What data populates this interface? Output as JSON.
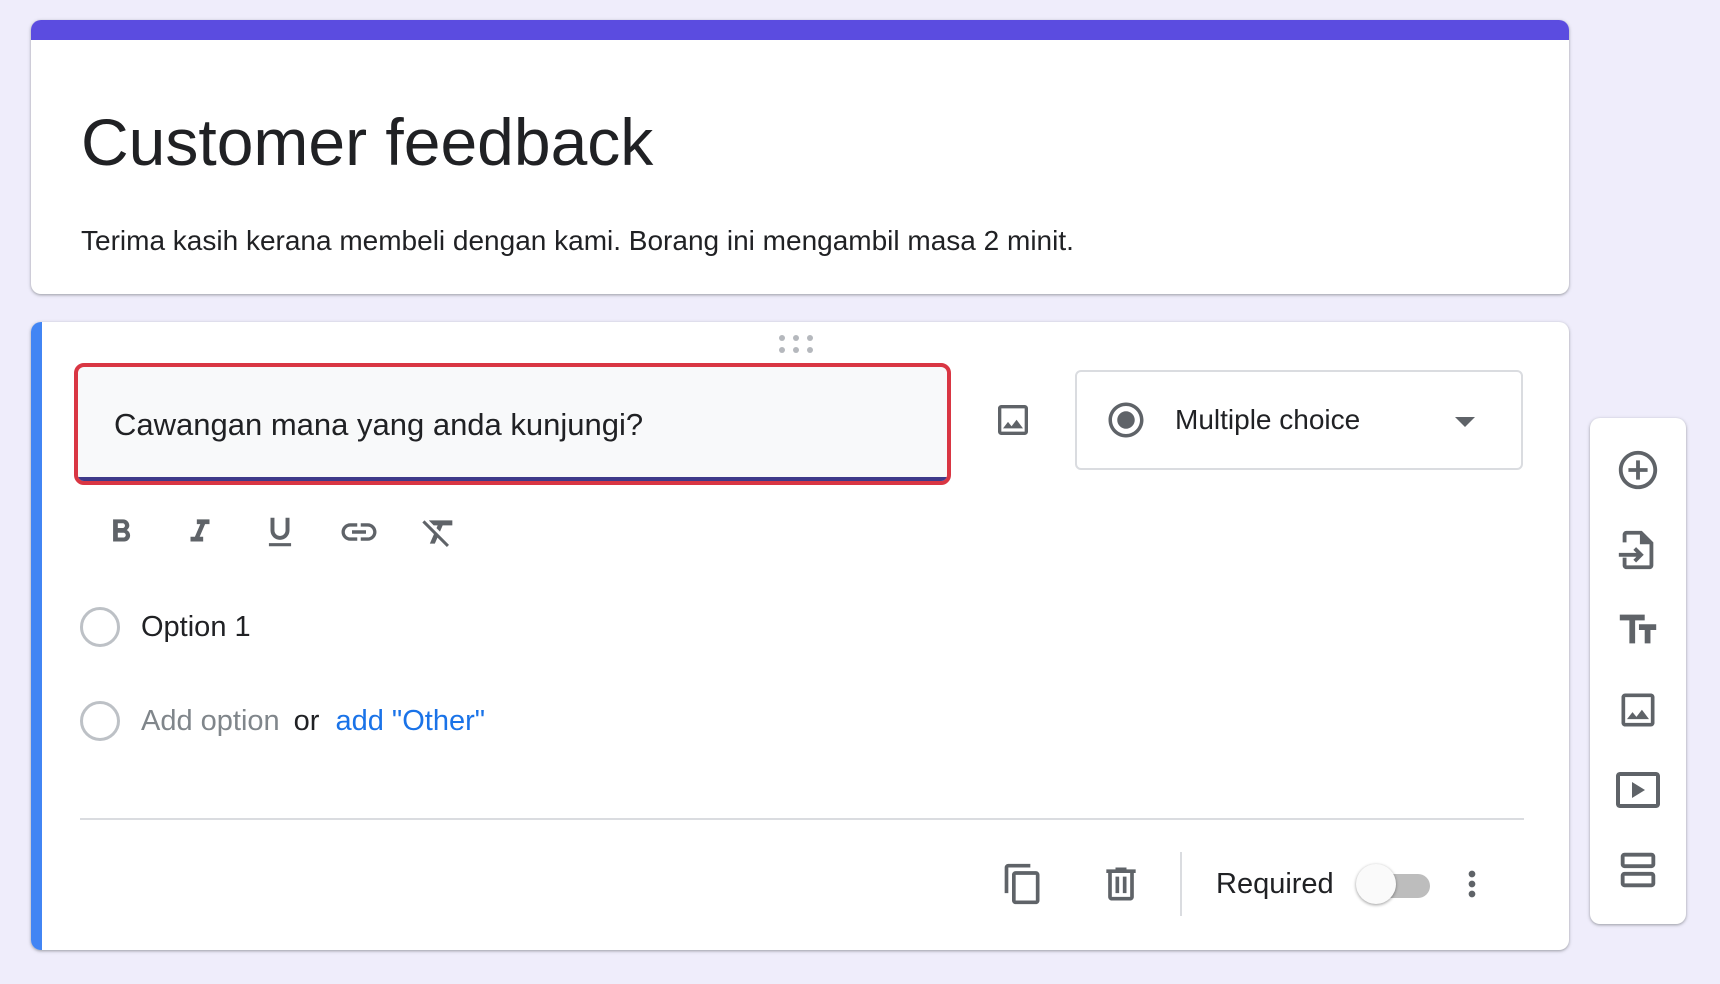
{
  "header": {
    "title": "Customer feedback",
    "description": "Terima kasih kerana membeli dengan kami. Borang ini mengambil masa 2 minit.",
    "accent_color": "#5b4ce0"
  },
  "question": {
    "text": "Cawangan mana yang anda kunjungi?",
    "type_selected": "Multiple choice",
    "options": [
      {
        "label": "Option 1"
      }
    ],
    "add_option_label": "Add option",
    "or_label": "or",
    "add_other_label": "add \"Other\"",
    "required_label": "Required",
    "required": false,
    "accent_color": "#4285f4",
    "field_highlight_color": "#d93643"
  },
  "icons": {
    "formatting": [
      "bold-icon",
      "italic-icon",
      "underline-icon",
      "link-icon",
      "clear-formatting-icon"
    ],
    "footer": [
      "duplicate-icon",
      "delete-icon",
      "more-vert-icon"
    ],
    "side_toolbar": [
      "add-question-icon",
      "import-questions-icon",
      "add-title-icon",
      "add-image-icon",
      "add-video-icon",
      "add-section-icon"
    ]
  },
  "colors": {
    "background": "#efedfb",
    "link": "#1a73e8",
    "icon": "#5f6368"
  }
}
